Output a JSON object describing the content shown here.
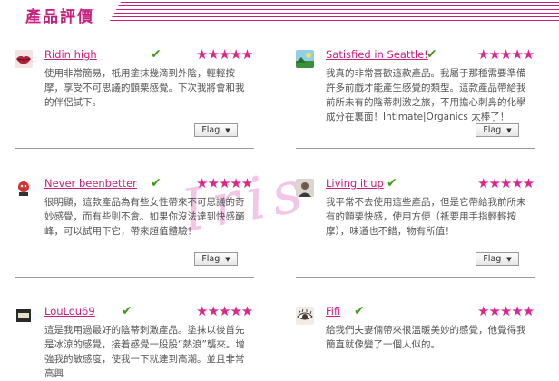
{
  "header": {
    "title": "產品評價"
  },
  "watermark": "Iris",
  "rating_max": 5,
  "flag_label": "Flag",
  "reviews": [
    {
      "name": "Ridin high",
      "verified": true,
      "rating": 5,
      "avatar_icon": "lips-avatar-icon",
      "text": "使用非常簡易，祇用塗抹幾滴到外陰，輕輕按摩，享受不可思議的顫栗感覺。下次我將會和我的伴侶試下。"
    },
    {
      "name": "Satisfied in Seattle!",
      "verified": true,
      "rating": 5,
      "avatar_icon": "landscape-avatar-icon",
      "text": "我真的非常喜歡這款產品。我屬于那種需要準備許多前戲才能產生感覺的類型。這款產品帶給我前所未有的陰蒂刺激之旅，不用擔心刺鼻的化學成分在裏面！Intimate|Organics 太棒了！"
    },
    {
      "name": "Never beenbetter",
      "verified": true,
      "rating": 5,
      "avatar_icon": "mascot-avatar-icon",
      "text": "很明顯，這款產品為有些女性帶來不可思議的奇妙感覺，而有些則不會。如果你沒法達到快感巔峰，可以試用下它，帶來超值體驗！"
    },
    {
      "name": "Living it up",
      "verified": true,
      "rating": 5,
      "avatar_icon": "portrait-avatar-icon",
      "text": "我平常不去使用這些產品，但是它帶給我前所未有的顫栗快感，使用方便（祇要用手指輕輕按摩），味道也不錯，物有所值！"
    },
    {
      "name": "LouLou69",
      "verified": true,
      "rating": 5,
      "avatar_icon": "badge-avatar-icon",
      "text": "這是我用過最好的陰蒂刺激產品。塗抹以後首先是冰涼的感覺，接着感覺一股股“熱浪”襲來。增強我的敏感度，使我一下就達到高潮。並且非常高興"
    },
    {
      "name": "Fifi",
      "verified": true,
      "rating": 5,
      "avatar_icon": "eye-avatar-icon",
      "text": "給我們夫妻倆帶來很溫暖美妙的感覺，他覺得我簡直就像變了一個人似的。"
    }
  ]
}
